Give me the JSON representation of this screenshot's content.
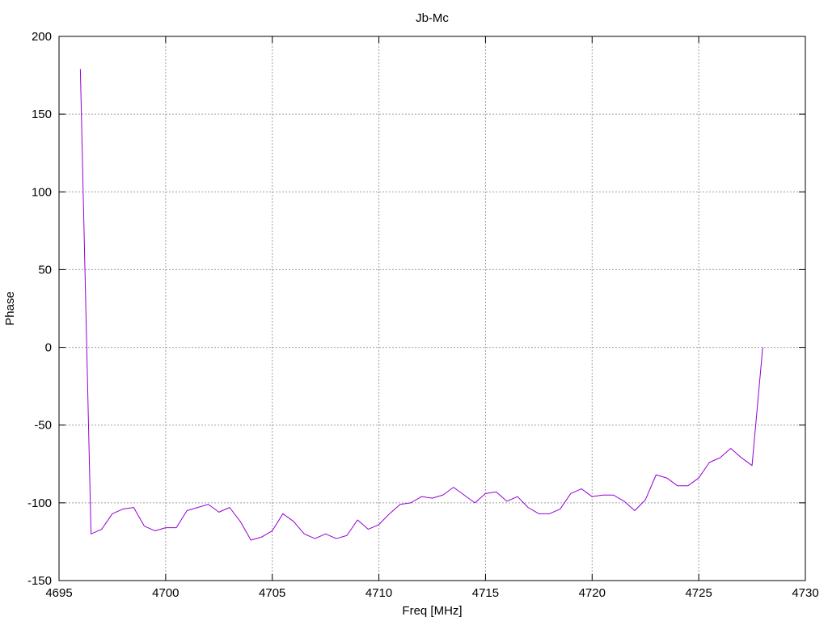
{
  "chart_data": {
    "type": "line",
    "title": "Jb-Mc",
    "xlabel": "Freq [MHz]",
    "ylabel": "Phase",
    "xlim": [
      4695,
      4730
    ],
    "ylim": [
      -150,
      200
    ],
    "xticks": [
      4695,
      4700,
      4705,
      4710,
      4715,
      4720,
      4725,
      4730
    ],
    "yticks": [
      -150,
      -100,
      -50,
      0,
      50,
      100,
      150,
      200
    ],
    "grid": true,
    "series": [
      {
        "color": "#9400d3",
        "x": [
          4696.0,
          4696.5,
          4697.0,
          4697.5,
          4698.0,
          4698.5,
          4699.0,
          4699.5,
          4700.0,
          4700.5,
          4701.0,
          4701.5,
          4702.0,
          4702.5,
          4703.0,
          4703.5,
          4704.0,
          4704.5,
          4705.0,
          4705.5,
          4706.0,
          4706.5,
          4707.0,
          4707.5,
          4708.0,
          4708.5,
          4709.0,
          4709.5,
          4710.0,
          4710.5,
          4711.0,
          4711.5,
          4712.0,
          4712.5,
          4713.0,
          4713.5,
          4714.0,
          4714.5,
          4715.0,
          4715.5,
          4716.0,
          4716.5,
          4717.0,
          4717.5,
          4718.0,
          4718.5,
          4719.0,
          4719.5,
          4720.0,
          4720.5,
          4721.0,
          4721.5,
          4722.0,
          4722.5,
          4723.0,
          4723.5,
          4724.0,
          4724.5,
          4725.0,
          4725.5,
          4726.0,
          4726.5,
          4727.0,
          4727.5,
          4728.0
        ],
        "y": [
          179,
          -120,
          -117,
          -107,
          -104,
          -103,
          -115,
          -118,
          -116,
          -116,
          -105,
          -103,
          -101,
          -106,
          -103,
          -112,
          -124,
          -122,
          -118,
          -107,
          -112,
          -120,
          -123,
          -120,
          -123,
          -121,
          -111,
          -117,
          -114,
          -107,
          -101,
          -100,
          -96,
          -97,
          -95,
          -90,
          -95,
          -100,
          -94,
          -93,
          -99,
          -96,
          -103,
          -107,
          -107,
          -104,
          -94,
          -91,
          -96,
          -95,
          -95,
          -99,
          -105,
          -98,
          -82,
          -84,
          -89,
          -89,
          -84,
          -74,
          -71,
          -65,
          -71,
          -76,
          0
        ]
      }
    ]
  }
}
